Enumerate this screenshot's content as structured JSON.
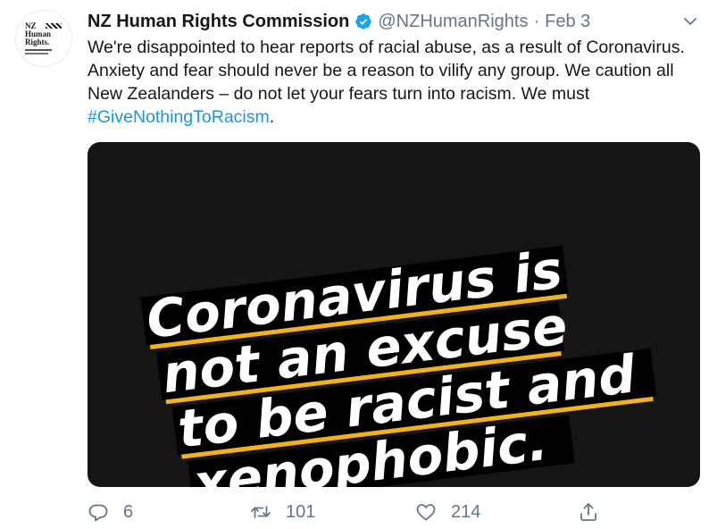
{
  "tweet": {
    "author": {
      "display_name": "NZ Human Rights Commission",
      "handle": "@NZHumanRights",
      "separator": "·",
      "timestamp": "Feb 3",
      "verified": true,
      "avatar_text": {
        "line1": "NZ",
        "line2": "Human",
        "line3": "Rights."
      }
    },
    "text_before_hashtag": "We're disappointed to hear reports of racial abuse, as a result of Coronavirus. Anxiety and fear should never be a reason to vilify any group. We caution all New Zealanders – do not let your fears turn into racism. We must ",
    "hashtag": "#GiveNothingToRacism",
    "text_after_hashtag": ".",
    "media": {
      "lines": [
        "Coronavirus is",
        "not an excuse",
        "to be racist and",
        "xenophobic."
      ],
      "background_color": "#151515",
      "underline_color": "#f2b21b",
      "text_color": "#ffffff"
    },
    "actions": {
      "reply_count": "6",
      "retweet_count": "101",
      "like_count": "214"
    },
    "colors": {
      "hashtag": "#1b95e0",
      "verified": "#1da1f2",
      "muted": "#657786"
    },
    "icons": {
      "verified": "verified-badge-icon",
      "caret": "chevron-down-icon",
      "reply": "reply-bubble-icon",
      "retweet": "retweet-arrows-icon",
      "like": "heart-icon",
      "share": "share-upload-icon"
    }
  }
}
